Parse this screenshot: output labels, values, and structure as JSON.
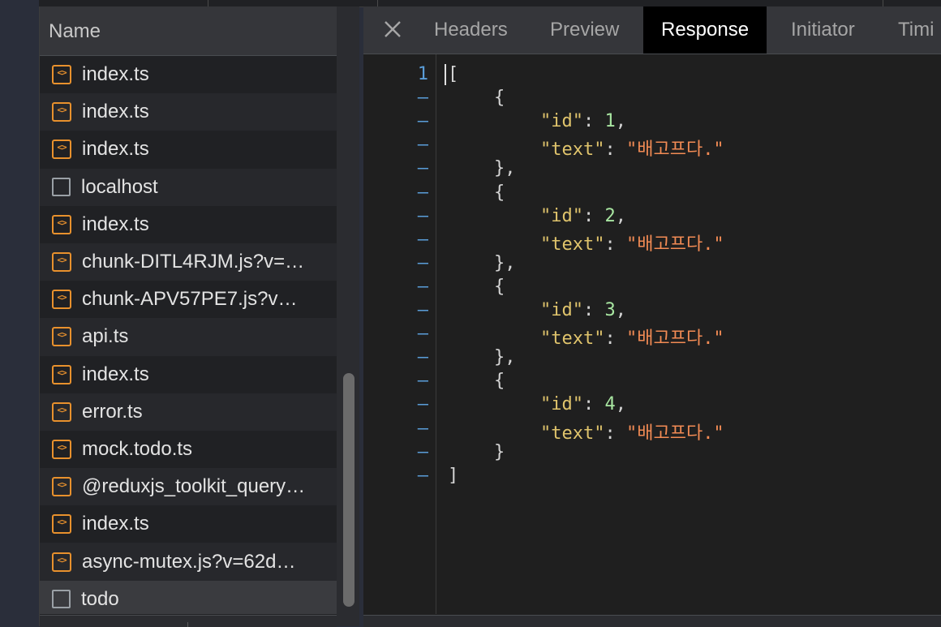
{
  "request_list": {
    "header": "Name",
    "rows": [
      {
        "name": "index.ts",
        "icon": "script-file-icon"
      },
      {
        "name": "index.ts",
        "icon": "script-file-icon"
      },
      {
        "name": "index.ts",
        "icon": "script-file-icon"
      },
      {
        "name": "localhost",
        "icon": "document-icon"
      },
      {
        "name": "index.ts",
        "icon": "script-file-icon"
      },
      {
        "name": "chunk-DITL4RJM.js?v=…",
        "icon": "script-file-icon"
      },
      {
        "name": "chunk-APV57PE7.js?v…",
        "icon": "script-file-icon"
      },
      {
        "name": "api.ts",
        "icon": "script-file-icon"
      },
      {
        "name": "index.ts",
        "icon": "script-file-icon"
      },
      {
        "name": "error.ts",
        "icon": "script-file-icon"
      },
      {
        "name": "mock.todo.ts",
        "icon": "script-file-icon"
      },
      {
        "name": "@reduxjs_toolkit_query…",
        "icon": "script-file-icon"
      },
      {
        "name": "index.ts",
        "icon": "script-file-icon"
      },
      {
        "name": "async-mutex.js?v=62d…",
        "icon": "script-file-icon"
      },
      {
        "name": "todo",
        "icon": "document-icon",
        "selected": true
      }
    ]
  },
  "detail": {
    "tabs": [
      "Headers",
      "Preview",
      "Response",
      "Initiator",
      "Timi"
    ],
    "active_tab": "Response",
    "line_numbers": [
      "1",
      "–",
      "–",
      "–",
      "–",
      "–",
      "–",
      "–",
      "–",
      "–",
      "–",
      "–",
      "–",
      "–",
      "–",
      "–",
      "–",
      "–"
    ],
    "code": {
      "open": "[",
      "close": "]",
      "brace_open": "{",
      "brace_close": "},",
      "brace_close_last": "}",
      "id_key": "\"id\"",
      "text_key": "\"text\"",
      "colon": ": ",
      "comma": ",",
      "items": [
        {
          "id": "1",
          "text": "\"배고프다.\""
        },
        {
          "id": "2",
          "text": "\"배고프다.\""
        },
        {
          "id": "3",
          "text": "\"배고프다.\""
        },
        {
          "id": "4",
          "text": "\"배고프다.\""
        }
      ]
    }
  },
  "colors": {
    "key": "#e0c46c",
    "number": "#a8e6a1",
    "string": "#f28b54",
    "script_icon": "#e8912d",
    "line_number": "#5a9dd8"
  }
}
